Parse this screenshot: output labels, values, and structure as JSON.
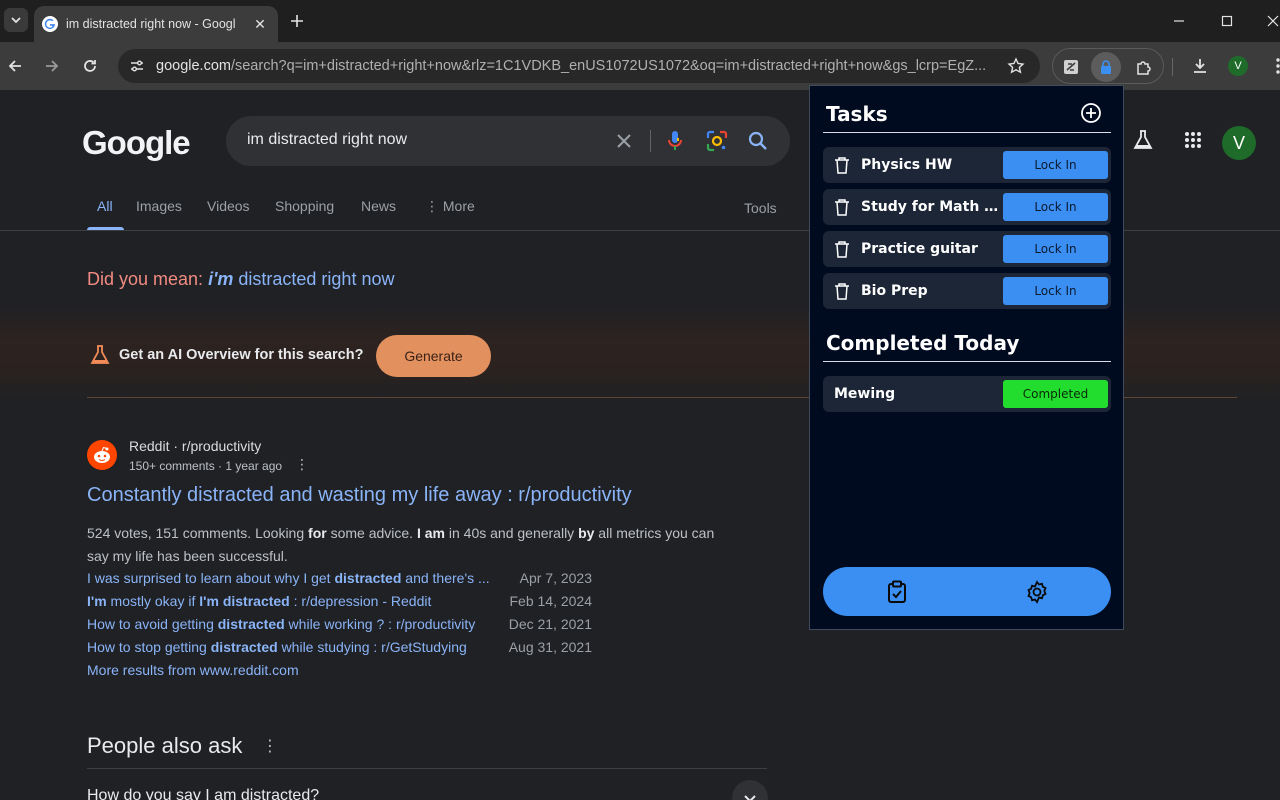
{
  "browser": {
    "tab_title": "im distracted right now - Googl",
    "url_host": "google.com",
    "url_rest": "/search?q=im+distracted+right+now&rlz=1C1VDKB_enUS1072US1072&oq=im+distracted+right+now&gs_lcrp=EgZ...",
    "profile_initial": "V"
  },
  "google": {
    "logo": "Google",
    "query": "im distracted right now",
    "tabs": [
      "All",
      "Images",
      "Videos",
      "Shopping",
      "News",
      "More"
    ],
    "tools": "Tools",
    "avatar_initial": "V",
    "did_you_mean": {
      "label": "Did you mean:",
      "bold": "i'm",
      "rest": "distracted right now"
    },
    "ai_overview": {
      "text": "Get an AI Overview for this search?",
      "button": "Generate"
    },
    "result": {
      "source": "Reddit · r/productivity",
      "meta": "150+ comments · 1 year ago",
      "title": "Constantly distracted and wasting my life away : r/productivity",
      "snippet_parts": [
        "524 votes, 151 comments. Looking ",
        "for",
        " some advice. ",
        "I am",
        " in 40s and generally ",
        "by",
        " all metrics you can say my life has been successful."
      ],
      "sublinks": [
        {
          "parts": [
            "I was surprised to learn about why I get ",
            "distracted",
            " and there's ..."
          ],
          "date": "Apr 7, 2023"
        },
        {
          "parts": [
            "I'm",
            " mostly okay if ",
            "I'm distracted",
            " : r/depression - Reddit"
          ],
          "date": "Feb 14, 2024"
        },
        {
          "parts": [
            "How to avoid getting ",
            "distracted",
            " while working ? : r/productivity"
          ],
          "date": "Dec 21, 2021"
        },
        {
          "parts": [
            "How to stop getting ",
            "distracted",
            " while studying : r/GetStudying"
          ],
          "date": "Aug 31, 2021"
        }
      ],
      "more_results": "More results from www.reddit.com"
    },
    "people_also_ask": {
      "title": "People also ask",
      "first_question": "How do you say I am distracted?"
    }
  },
  "extension": {
    "tasks_heading": "Tasks",
    "tasks": [
      {
        "name": "Physics HW",
        "button": "Lock In"
      },
      {
        "name": "Study for Math Fi...",
        "button": "Lock In"
      },
      {
        "name": "Practice guitar",
        "button": "Lock In"
      },
      {
        "name": "Bio Prep",
        "button": "Lock In"
      }
    ],
    "completed_heading": "Completed Today",
    "completed": [
      {
        "name": "Mewing",
        "status": "Completed"
      }
    ]
  },
  "colors": {
    "link_blue": "#8ab4f8",
    "did_you_mean_red": "#f28b82",
    "popup_bg": "#010b1f",
    "lock_in_blue": "#3b8ff2",
    "completed_green": "#22dd2e",
    "generate_orange": "#e3905f"
  },
  "icons": [
    "chevron-down-icon",
    "google-favicon",
    "close-icon",
    "plus-icon",
    "minimize-icon",
    "maximize-icon",
    "back-arrow-icon",
    "forward-arrow-icon",
    "reload-icon",
    "site-settings-icon",
    "star-icon",
    "extension-icon",
    "lock-icon",
    "puzzle-icon",
    "download-icon",
    "kebab-menu-icon",
    "clear-icon",
    "mic-icon",
    "lens-icon",
    "search-icon",
    "labs-flask-icon",
    "apps-grid-icon",
    "reddit-icon",
    "add-circle-icon",
    "trash-icon",
    "clipboard-check-icon",
    "gear-icon"
  ]
}
